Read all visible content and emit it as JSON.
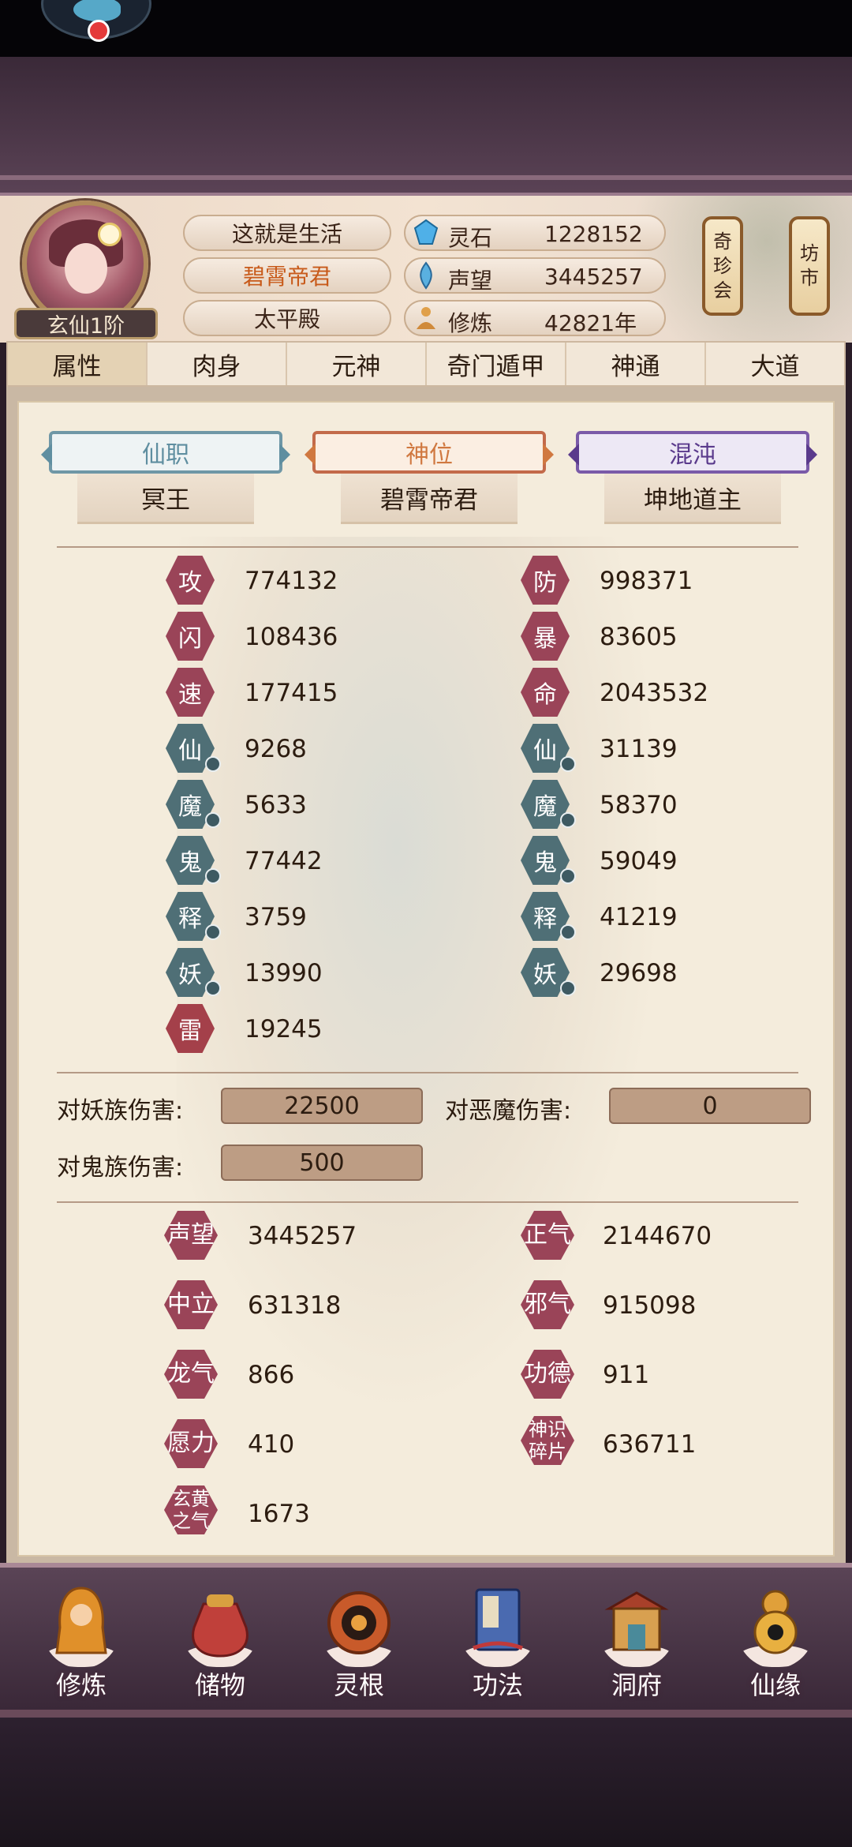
{
  "header": {
    "rank": "玄仙1阶",
    "name": "这就是生活",
    "title": "碧霄帝君",
    "palace": "太平殿",
    "resources": [
      {
        "label": "灵石",
        "value": "1228152",
        "icon": "spirit-stone-icon"
      },
      {
        "label": "声望",
        "value": "3445257",
        "icon": "reputation-icon"
      },
      {
        "label": "修炼",
        "value": "42821年",
        "icon": "cultivation-icon"
      }
    ],
    "side_buttons": [
      {
        "label_lines": [
          "奇",
          "珍",
          "会"
        ]
      },
      {
        "label_lines": [
          "坊",
          "市"
        ]
      }
    ]
  },
  "tabs": [
    "属性",
    "肉身",
    "元神",
    "奇门遁甲",
    "神通",
    "大道"
  ],
  "active_tab": "属性",
  "titles": [
    {
      "banner": "仙职",
      "value": "冥王"
    },
    {
      "banner": "神位",
      "value": "碧霄帝君"
    },
    {
      "banner": "混沌",
      "value": "坤地道主"
    }
  ],
  "stats_left": [
    {
      "icon": "攻",
      "value": "774132"
    },
    {
      "icon": "闪",
      "value": "108436"
    },
    {
      "icon": "速",
      "value": "177415"
    },
    {
      "icon": "仙",
      "value": "9268"
    },
    {
      "icon": "魔",
      "value": "5633"
    },
    {
      "icon": "鬼",
      "value": "77442"
    },
    {
      "icon": "释",
      "value": "3759"
    },
    {
      "icon": "妖",
      "value": "13990"
    },
    {
      "icon": "雷",
      "value": "19245"
    }
  ],
  "stats_right": [
    {
      "icon": "防",
      "value": "998371"
    },
    {
      "icon": "暴",
      "value": "83605"
    },
    {
      "icon": "命",
      "value": "2043532"
    },
    {
      "icon": "仙",
      "value": "31139"
    },
    {
      "icon": "魔",
      "value": "58370"
    },
    {
      "icon": "鬼",
      "value": "59049"
    },
    {
      "icon": "释",
      "value": "41219"
    },
    {
      "icon": "妖",
      "value": "29698"
    }
  ],
  "damage": [
    {
      "label": "对妖族伤害:",
      "value": "22500"
    },
    {
      "label": "对恶魔伤害:",
      "value": "0"
    },
    {
      "label": "对鬼族伤害:",
      "value": "500"
    }
  ],
  "misc_left": [
    {
      "icon": "声望",
      "value": "3445257"
    },
    {
      "icon": "中立",
      "value": "631318"
    },
    {
      "icon": "龙气",
      "value": "866"
    },
    {
      "icon": "愿力",
      "value": "410"
    },
    {
      "icon_lines": [
        "玄黄",
        "之气"
      ],
      "value": "1673"
    }
  ],
  "misc_right": [
    {
      "icon": "正气",
      "value": "2144670"
    },
    {
      "icon": "邪气",
      "value": "915098"
    },
    {
      "icon": "功德",
      "value": "911"
    },
    {
      "icon_lines": [
        "神识",
        "碎片"
      ],
      "value": "636711"
    }
  ],
  "bottom_nav": [
    {
      "label": "修炼",
      "icon": "monk-icon"
    },
    {
      "label": "储物",
      "icon": "bag-icon"
    },
    {
      "label": "灵根",
      "icon": "spirit-root-icon"
    },
    {
      "label": "功法",
      "icon": "book-icon"
    },
    {
      "label": "洞府",
      "icon": "cave-icon"
    },
    {
      "label": "仙缘",
      "icon": "gourd-icon"
    }
  ]
}
